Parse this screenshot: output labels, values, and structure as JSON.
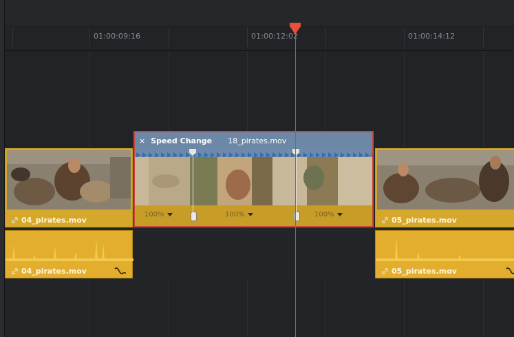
{
  "timeline": {
    "timecodes": [
      "01:00:09:16",
      "01:00:12:02",
      "01:00:14:12"
    ],
    "playhead_timecode": "01:00:12:02",
    "colors": {
      "playhead": "#e8503a",
      "video_clip": "#d5a72a",
      "speed_header": "#6d87a7",
      "selected_border": "#c9473a"
    }
  },
  "video_track": {
    "clips": [
      {
        "name": "04_pirates.mov",
        "icon": "link-icon"
      },
      {
        "name": "05_pirates.mov",
        "icon": "link-icon"
      }
    ]
  },
  "speed_clip": {
    "close_symbol": "×",
    "title": "Speed Change",
    "file": "18_pirates.mov",
    "segments": [
      {
        "speed": "100%"
      },
      {
        "speed": "100%"
      },
      {
        "speed": "100%"
      }
    ]
  },
  "audio_track": {
    "clips": [
      {
        "name": "04_pirates.mov",
        "icon": "link-icon",
        "curve_icon": "curve-icon"
      },
      {
        "name": "05_pirates.mov",
        "icon": "link-icon",
        "curve_icon": "curve-icon"
      }
    ]
  }
}
